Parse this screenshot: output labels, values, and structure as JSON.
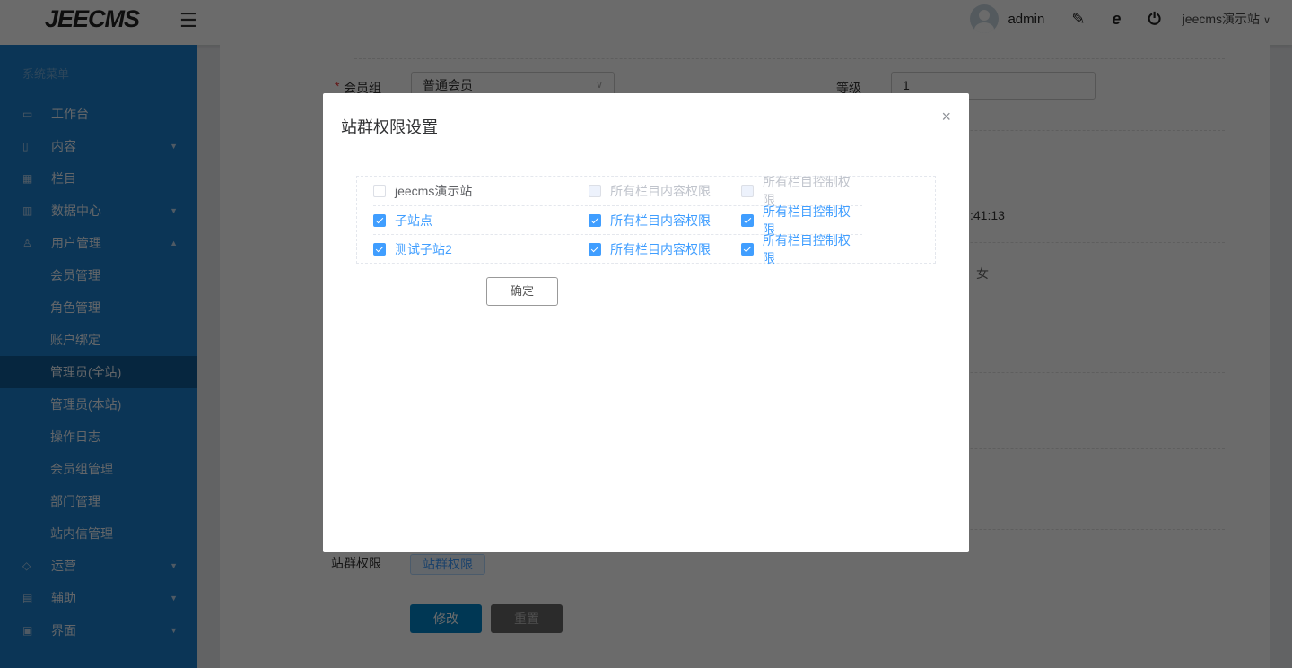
{
  "header": {
    "logo": "JEECMS",
    "user": "admin",
    "site": "jeecms演示站",
    "icons": [
      "menu-icon",
      "user-edit-icon",
      "ie-browser-icon",
      "power-icon",
      "chevron-down-icon"
    ]
  },
  "sidebar": {
    "title": "系统菜单",
    "items": [
      {
        "label": "工作台",
        "icon": "monitor-icon"
      },
      {
        "label": "内容",
        "icon": "document-icon",
        "arrow": "down"
      },
      {
        "label": "栏目",
        "icon": "grid-icon"
      },
      {
        "label": "数据中心",
        "icon": "bar-chart-icon",
        "arrow": "down"
      },
      {
        "label": "用户管理",
        "icon": "user-icon",
        "arrow": "up"
      },
      {
        "label": "会员管理",
        "sub": true
      },
      {
        "label": "角色管理",
        "sub": true
      },
      {
        "label": "账户绑定",
        "sub": true
      },
      {
        "label": "管理员(全站)",
        "sub": true,
        "active": true
      },
      {
        "label": "管理员(本站)",
        "sub": true
      },
      {
        "label": "操作日志",
        "sub": true
      },
      {
        "label": "会员组管理",
        "sub": true
      },
      {
        "label": "部门管理",
        "sub": true
      },
      {
        "label": "站内信管理",
        "sub": true
      },
      {
        "label": "运营",
        "icon": "shield-icon",
        "arrow": "down"
      },
      {
        "label": "辅助",
        "icon": "box-icon",
        "arrow": "down"
      },
      {
        "label": "界面",
        "icon": "layout-icon",
        "arrow": "down"
      }
    ]
  },
  "form": {
    "required_mark": "*",
    "group_label": "会员组",
    "group_value": "普通会员",
    "level_label": "等级",
    "level_value": "1",
    "time_fragment": ":41:13",
    "gender_fragment": "女",
    "site_perm_label": "站群权限",
    "site_perm_button": "站群权限",
    "submit": "修改",
    "reset": "重置"
  },
  "dialog": {
    "title": "站群权限设置",
    "close": "×",
    "confirm": "确定",
    "rows": [
      {
        "site": "jeecms演示站",
        "site_checked": false,
        "content": "所有栏目内容权限",
        "content_checked": false,
        "content_disabled": true,
        "control": "所有栏目控制权限",
        "control_checked": false,
        "control_disabled": true
      },
      {
        "site": "子站点",
        "site_checked": true,
        "content": "所有栏目内容权限",
        "content_checked": true,
        "content_disabled": false,
        "control": "所有栏目控制权限",
        "control_checked": true,
        "control_disabled": false
      },
      {
        "site": "测试子站2",
        "site_checked": true,
        "content": "所有栏目内容权限",
        "content_checked": true,
        "content_disabled": false,
        "control": "所有栏目控制权限",
        "control_checked": true,
        "control_disabled": false
      }
    ]
  },
  "colors": {
    "accent": "#409eff",
    "sidebar": "#1a7fcc",
    "submit": "#0084c9",
    "reset": "#666666"
  }
}
